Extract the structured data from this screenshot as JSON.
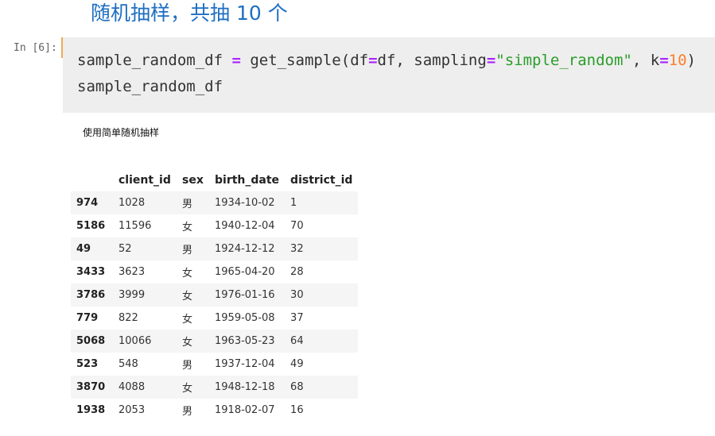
{
  "markdown": {
    "heading": "随机抽样，共抽 10 个"
  },
  "cell": {
    "prompt": "In [6]:",
    "code": {
      "line1": {
        "var": "sample_random_df ",
        "eq": "=",
        "call": " get_sample(df",
        "eq2": "=",
        "arg1": "df, sampling",
        "eq3": "=",
        "str": "\"simple_random\"",
        "sep": ", k",
        "eq4": "=",
        "num": "10",
        "close": ")"
      },
      "line2": "sample_random_df"
    }
  },
  "output": {
    "caption": "使用简单随机抽样",
    "table": {
      "columns": [
        "",
        "client_id",
        "sex",
        "birth_date",
        "district_id"
      ],
      "rows": [
        {
          "index": "974",
          "client_id": "1028",
          "sex": "男",
          "birth_date": "1934-10-02",
          "district_id": "1"
        },
        {
          "index": "5186",
          "client_id": "11596",
          "sex": "女",
          "birth_date": "1940-12-04",
          "district_id": "70"
        },
        {
          "index": "49",
          "client_id": "52",
          "sex": "男",
          "birth_date": "1924-12-12",
          "district_id": "32"
        },
        {
          "index": "3433",
          "client_id": "3623",
          "sex": "女",
          "birth_date": "1965-04-20",
          "district_id": "28"
        },
        {
          "index": "3786",
          "client_id": "3999",
          "sex": "女",
          "birth_date": "1976-01-16",
          "district_id": "30"
        },
        {
          "index": "779",
          "client_id": "822",
          "sex": "女",
          "birth_date": "1959-05-08",
          "district_id": "37"
        },
        {
          "index": "5068",
          "client_id": "10066",
          "sex": "女",
          "birth_date": "1963-05-23",
          "district_id": "64"
        },
        {
          "index": "523",
          "client_id": "548",
          "sex": "男",
          "birth_date": "1937-12-04",
          "district_id": "49"
        },
        {
          "index": "3870",
          "client_id": "4088",
          "sex": "女",
          "birth_date": "1948-12-18",
          "district_id": "68"
        },
        {
          "index": "1938",
          "client_id": "2053",
          "sex": "男",
          "birth_date": "1918-02-07",
          "district_id": "16"
        }
      ]
    }
  },
  "colors": {
    "heading": "#1d6fc2",
    "code_background": "#eeeeee",
    "cell_marker": "#f0a955",
    "operator": "#aa22ff",
    "string": "#2a9d2a",
    "number": "#ff7f2a",
    "row_stripe": "#f5f5f5"
  }
}
